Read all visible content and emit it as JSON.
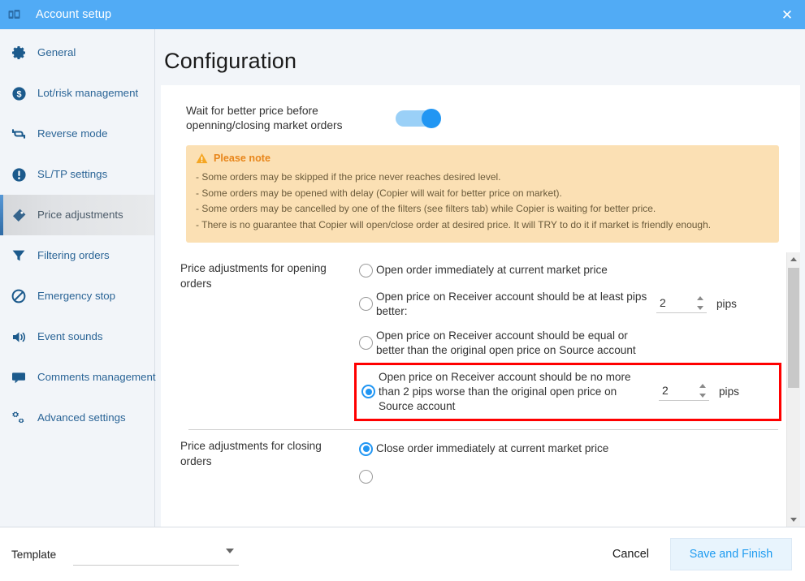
{
  "window": {
    "title": "Account setup",
    "app_icon": "books-icon",
    "close_icon": "close-icon",
    "titlebar_color": "#51ABF5"
  },
  "sidebar": {
    "items": [
      {
        "label": "General",
        "icon": "gear-icon",
        "active": false
      },
      {
        "label": "Lot/risk management",
        "icon": "dollar-icon",
        "active": false
      },
      {
        "label": "Reverse mode",
        "icon": "refresh-icon",
        "active": false
      },
      {
        "label": "SL/TP settings",
        "icon": "exclamation-icon",
        "active": false
      },
      {
        "label": "Price adjustments",
        "icon": "tag-icon",
        "active": true
      },
      {
        "label": "Filtering orders",
        "icon": "filter-icon",
        "active": false
      },
      {
        "label": "Emergency stop",
        "icon": "no-entry-icon",
        "active": false
      },
      {
        "label": "Event sounds",
        "icon": "speaker-icon",
        "active": false
      },
      {
        "label": "Comments management",
        "icon": "comment-icon",
        "active": false
      },
      {
        "label": "Advanced settings",
        "icon": "gears-icon",
        "active": false
      }
    ]
  },
  "main": {
    "page_title": "Configuration",
    "wait_toggle": {
      "label": "Wait for better price before openning/closing market orders",
      "state": "on"
    },
    "note": {
      "icon": "warning-triangle-icon",
      "title": "Please note",
      "lines": [
        "- Some orders may be skipped if the price never reaches desired level.",
        "- Some orders may be opened with delay (Copier will wait for better price on market).",
        "- Some orders may be cancelled by one of the filters (see filters tab) while Copier is waiting for better price.",
        "- There is no guarantee that Copier will open/close order at desired price. It will TRY to do it if market is friendly enough."
      ]
    },
    "opening_group": {
      "label": "Price adjustments for opening orders",
      "options": [
        {
          "text": "Open order immediately  at current market price",
          "selected": false,
          "spinner": null
        },
        {
          "text": "Open price on Receiver account should be at least pips better:",
          "selected": false,
          "spinner": {
            "value": "2",
            "unit": "pips"
          }
        },
        {
          "text": "Open price on Receiver account should be equal or better than the original open price on Source account",
          "selected": false,
          "spinner": null
        },
        {
          "text": "Open price on Receiver account should be no more than 2 pips worse than the original open price on Source account",
          "selected": true,
          "highlighted": true,
          "spinner": {
            "value": "2",
            "unit": "pips"
          }
        }
      ]
    },
    "closing_group": {
      "label": "Price adjustments for closing orders",
      "options": [
        {
          "text": "Close order immediately at current market price",
          "selected": true,
          "spinner": null
        }
      ]
    },
    "scrollbar": {
      "up_icon": "scroll-up-icon",
      "down_icon": "scroll-down-icon"
    }
  },
  "footer": {
    "template_label": "Template",
    "template_value": "",
    "template_caret_icon": "chevron-down-icon",
    "cancel_label": "Cancel",
    "save_label": "Save and Finish",
    "save_color": "#1E9BF0"
  }
}
